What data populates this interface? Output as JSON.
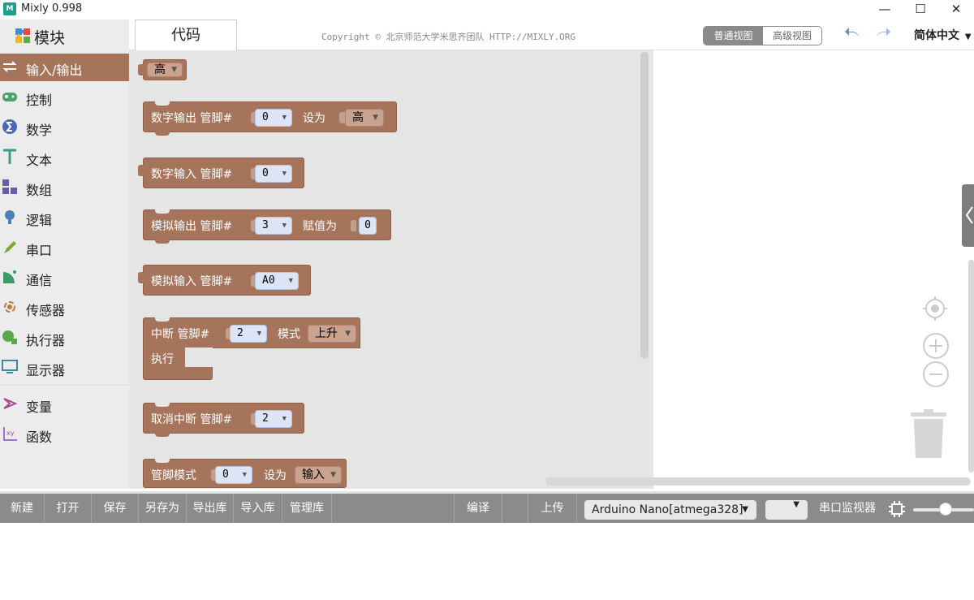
{
  "window": {
    "title": "Mixly 0.998",
    "minimize": "—",
    "maximize": "☐",
    "close": "✕"
  },
  "header": {
    "blocks_tab": "模块",
    "code_tab": "代码",
    "copyright": "Copyright © 北京师范大学米思齐团队 HTTP://MIXLY.ORG",
    "view_normal": "普通视图",
    "view_advanced": "高级视图",
    "language": "简体中文"
  },
  "categories": [
    {
      "label": "输入/输出",
      "icon": "arrows-icon",
      "active": true
    },
    {
      "label": "控制",
      "icon": "gamepad-icon"
    },
    {
      "label": "数学",
      "icon": "sigma-icon"
    },
    {
      "label": "文本",
      "icon": "text-t-icon"
    },
    {
      "label": "数组",
      "icon": "blocks-icon"
    },
    {
      "label": "逻辑",
      "icon": "bulb-icon"
    },
    {
      "label": "串口",
      "icon": "pen-icon"
    },
    {
      "label": "通信",
      "icon": "satellite-icon"
    },
    {
      "label": "传感器",
      "icon": "sensor-icon"
    },
    {
      "label": "执行器",
      "icon": "actuator-icon"
    },
    {
      "label": "显示器",
      "icon": "monitor-icon"
    },
    {
      "label": "变量",
      "icon": "variable-icon"
    },
    {
      "label": "函数",
      "icon": "function-icon"
    }
  ],
  "blocks": {
    "b0": {
      "value": "高"
    },
    "b1": {
      "label": "数字输出 管脚#",
      "pin": "0",
      "label2": "设为",
      "value": "高"
    },
    "b2": {
      "label": "数字输入 管脚#",
      "pin": "0"
    },
    "b3": {
      "label": "模拟输出 管脚#",
      "pin": "3",
      "label2": "赋值为",
      "value": "0"
    },
    "b4": {
      "label": "模拟输入 管脚#",
      "pin": "A0"
    },
    "b5": {
      "label": "中断 管脚#",
      "pin": "2",
      "label2": "模式",
      "mode": "上升",
      "label3": "执行"
    },
    "b6": {
      "label": "取消中断 管脚#",
      "pin": "2"
    },
    "b7": {
      "label": "管脚模式",
      "pin": "0",
      "label2": "设为",
      "mode": "输入"
    }
  },
  "toolbar": {
    "new": "新建",
    "open": "打开",
    "save": "保存",
    "save_as": "另存为",
    "export_lib": "导出库",
    "import_lib": "导入库",
    "manage_lib": "管理库",
    "compile": "编译",
    "upload": "上传",
    "board": "Arduino Nano[atmega328]",
    "serial_monitor": "串口监视器"
  },
  "colors": {
    "io_block": "#a5745b",
    "toolbar": "#8b8b8b",
    "sidebar": "#ececec",
    "flyout": "#e5e5e5"
  }
}
